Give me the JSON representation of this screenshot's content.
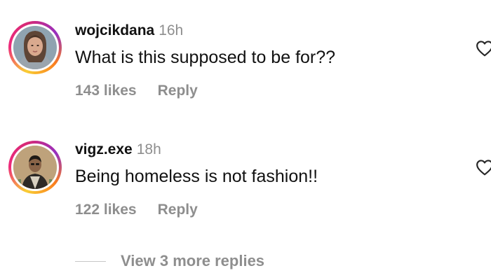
{
  "comments": [
    {
      "username": "wojcikdana",
      "time": "16h",
      "text": "What is this supposed to be for??",
      "likes": "143 likes",
      "reply_label": "Reply",
      "avatar_icon": "user-avatar-woman",
      "like_icon": "heart-outline-icon"
    },
    {
      "username": "vigz.exe",
      "time": "18h",
      "text": "Being homeless is not fashion!!",
      "likes": "122 likes",
      "reply_label": "Reply",
      "avatar_icon": "user-avatar-man",
      "like_icon": "heart-outline-icon"
    }
  ],
  "view_replies": {
    "label": "View 3 more replies"
  },
  "colors": {
    "secondary_text": "#8e8e8e",
    "primary_text": "#111111",
    "story_ring_gradient": [
      "#f9ce34",
      "#ee2a7b",
      "#962fbf",
      "#fa7e1e"
    ]
  }
}
